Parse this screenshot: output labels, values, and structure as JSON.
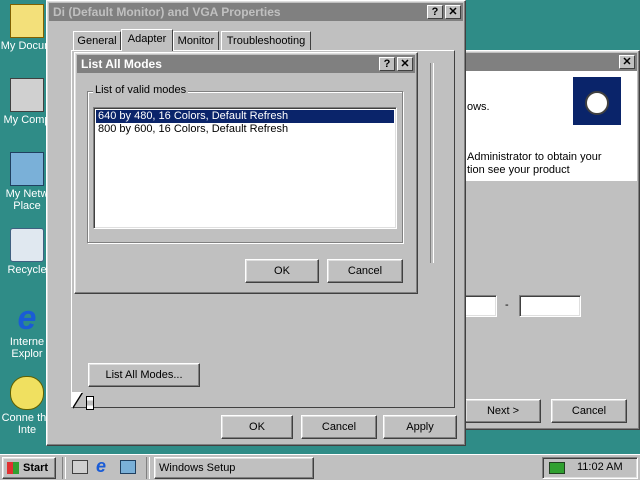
{
  "desktop": {
    "icons": [
      {
        "label": "My Docum",
        "name": "my-documents-icon"
      },
      {
        "label": "My Comp",
        "name": "my-computer-icon"
      },
      {
        "label": "My Netw Place",
        "name": "network-places-icon"
      },
      {
        "label": "Recycle",
        "name": "recycle-bin-icon"
      },
      {
        "label": "Interne Explor",
        "name": "internet-explorer-icon"
      },
      {
        "label": "Conne the Inte",
        "name": "connect-internet-icon"
      }
    ]
  },
  "setup_window": {
    "text_line1": "ows.",
    "text_line2": "Administrator to obtain your",
    "text_line3": "tion see your product",
    "next_button": "Next >",
    "cancel_button": "Cancel",
    "dash": "-"
  },
  "properties": {
    "title": "Di (Default Monitor) and VGA Properties",
    "tabs": [
      "General",
      "Adapter",
      "Monitor",
      "Troubleshooting"
    ],
    "list_all_modes_button": "List All Modes...",
    "ok": "OK",
    "cancel": "Cancel",
    "apply": "Apply",
    "help_btn": "?",
    "close_btn": "✕"
  },
  "modes_dialog": {
    "title": "List All Modes",
    "group_label": "List of valid modes",
    "modes": [
      "640 by 480, 16 Colors, Default Refresh",
      "800 by 600, 16 Colors, Default Refresh"
    ],
    "ok": "OK",
    "cancel": "Cancel",
    "help_btn": "?",
    "close_btn": "✕"
  },
  "taskbar": {
    "start": "Start",
    "task": "Windows Setup",
    "clock": "11:02 AM"
  },
  "colors": {
    "desktop": "#2f8c87",
    "active_title": "#0a246a",
    "face": "#c0c0c0"
  }
}
